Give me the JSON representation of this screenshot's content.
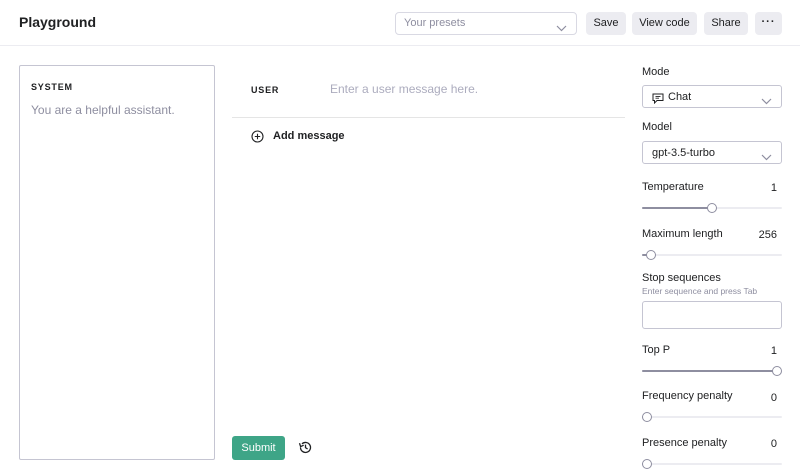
{
  "header": {
    "title": "Playground",
    "presets_placeholder": "Your presets",
    "save_label": "Save",
    "view_code_label": "View code",
    "share_label": "Share",
    "more_label": "···"
  },
  "system": {
    "label": "SYSTEM",
    "placeholder": "You are a helpful assistant."
  },
  "conversation": {
    "user_label": "USER",
    "user_placeholder": "Enter a user message here.",
    "add_message_label": "Add message",
    "submit_label": "Submit"
  },
  "settings": {
    "mode": {
      "label": "Mode",
      "value": "Chat"
    },
    "model": {
      "label": "Model",
      "value": "gpt-3.5-turbo"
    },
    "temperature": {
      "label": "Temperature",
      "value": "1",
      "fraction": 0.5
    },
    "maximum_length": {
      "label": "Maximum length",
      "value": "256",
      "fraction": 0.03
    },
    "stop_sequences": {
      "label": "Stop sequences",
      "hint": "Enter sequence and press Tab"
    },
    "top_p": {
      "label": "Top P",
      "value": "1",
      "fraction": 1.0
    },
    "frequency_penalty": {
      "label": "Frequency penalty",
      "value": "0",
      "fraction": 0.0
    },
    "presence_penalty": {
      "label": "Presence penalty",
      "value": "0",
      "fraction": 0.0
    }
  },
  "colors": {
    "accent": "#3ea587",
    "border": "#c5c5d2",
    "muted_text": "#8e8ea0"
  }
}
